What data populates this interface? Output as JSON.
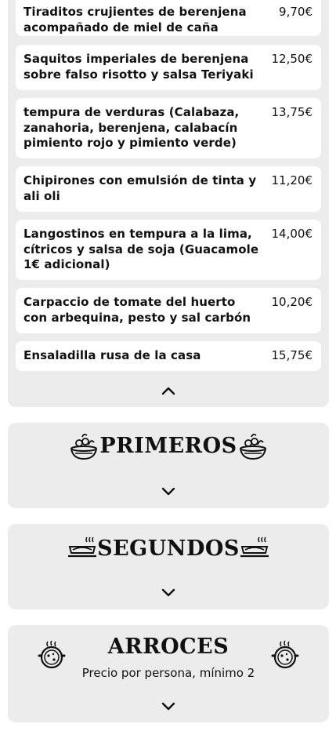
{
  "entrantes": {
    "dishes": [
      {
        "name": "Tiraditos crujientes de berenjena acompañado de miel de caña",
        "price": "9,70€"
      },
      {
        "name": "Saquitos imperiales de berenjena sobre falso risotto y salsa Teriyaki",
        "price": "12,50€"
      },
      {
        "name": "tempura de verduras (Calabaza, zanahoria, berenjena, calabacín pimiento rojo y pimiento verde)",
        "price": "13,75€"
      },
      {
        "name": "Chipirones con emulsión de tinta y ali oli",
        "price": "11,20€"
      },
      {
        "name": "Langostinos en tempura a la lima, cítricos y salsa de soja (Guacamole 1€ adicional)",
        "price": "14,00€"
      },
      {
        "name": "Carpaccio de tomate del huerto con arbequina, pesto y sal carbón",
        "price": "10,20€"
      },
      {
        "name": "Ensaladilla rusa de la casa",
        "price": "15,75€"
      }
    ],
    "toggle_icon": "chevron-up-icon"
  },
  "sections": [
    {
      "title": "PRIMEROS",
      "subtitle": "",
      "icon": "salad-bowl-icon",
      "toggle_icon": "chevron-down-icon"
    },
    {
      "title": "SEGUNDOS",
      "subtitle": "",
      "icon": "hot-plate-icon",
      "toggle_icon": "chevron-down-icon"
    },
    {
      "title": "ARROCES",
      "subtitle": "Precio por persona, mínimo 2",
      "icon": "paella-pan-icon",
      "toggle_icon": "chevron-down-icon"
    }
  ]
}
